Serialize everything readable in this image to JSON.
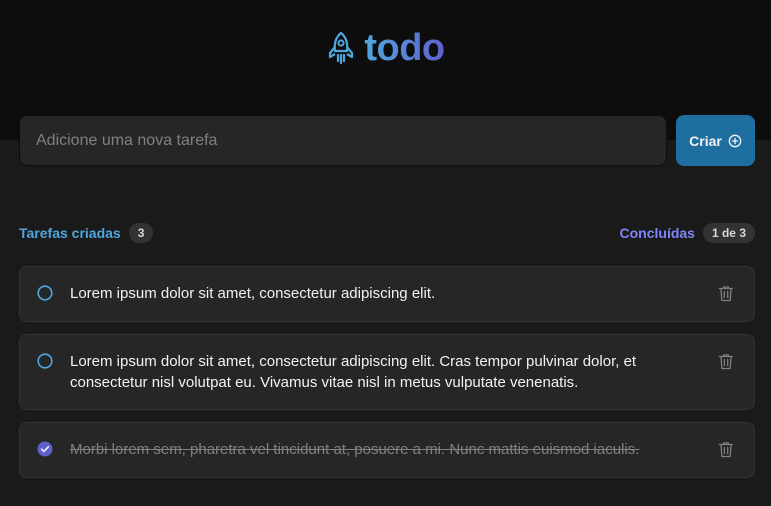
{
  "app": {
    "title": "todo",
    "colors": {
      "accent_blue": "#4ea8de",
      "accent_purple": "#5e60ce",
      "button": "#1e6f9f"
    }
  },
  "new_task": {
    "placeholder": "Adicione uma nova tarefa",
    "value": "",
    "create_label": "Criar",
    "create_icon": "plus-circle-icon"
  },
  "counters": {
    "created_label": "Tarefas criadas",
    "created_count": "3",
    "done_label": "Concluídas",
    "done_count": "1 de 3"
  },
  "tasks": [
    {
      "text": "Lorem ipsum dolor sit amet, consectetur adipiscing elit.",
      "completed": false
    },
    {
      "text": "Lorem ipsum dolor sit amet, consectetur adipiscing elit. Cras tempor pulvinar dolor, et consectetur nisl volutpat eu. Vivamus vitae nisl in metus vulputate venenatis.",
      "completed": false
    },
    {
      "text": "Morbi lorem sem, pharetra vel tincidunt at, posuere a mi. Nunc mattis euismod iaculis.",
      "completed": true
    }
  ]
}
